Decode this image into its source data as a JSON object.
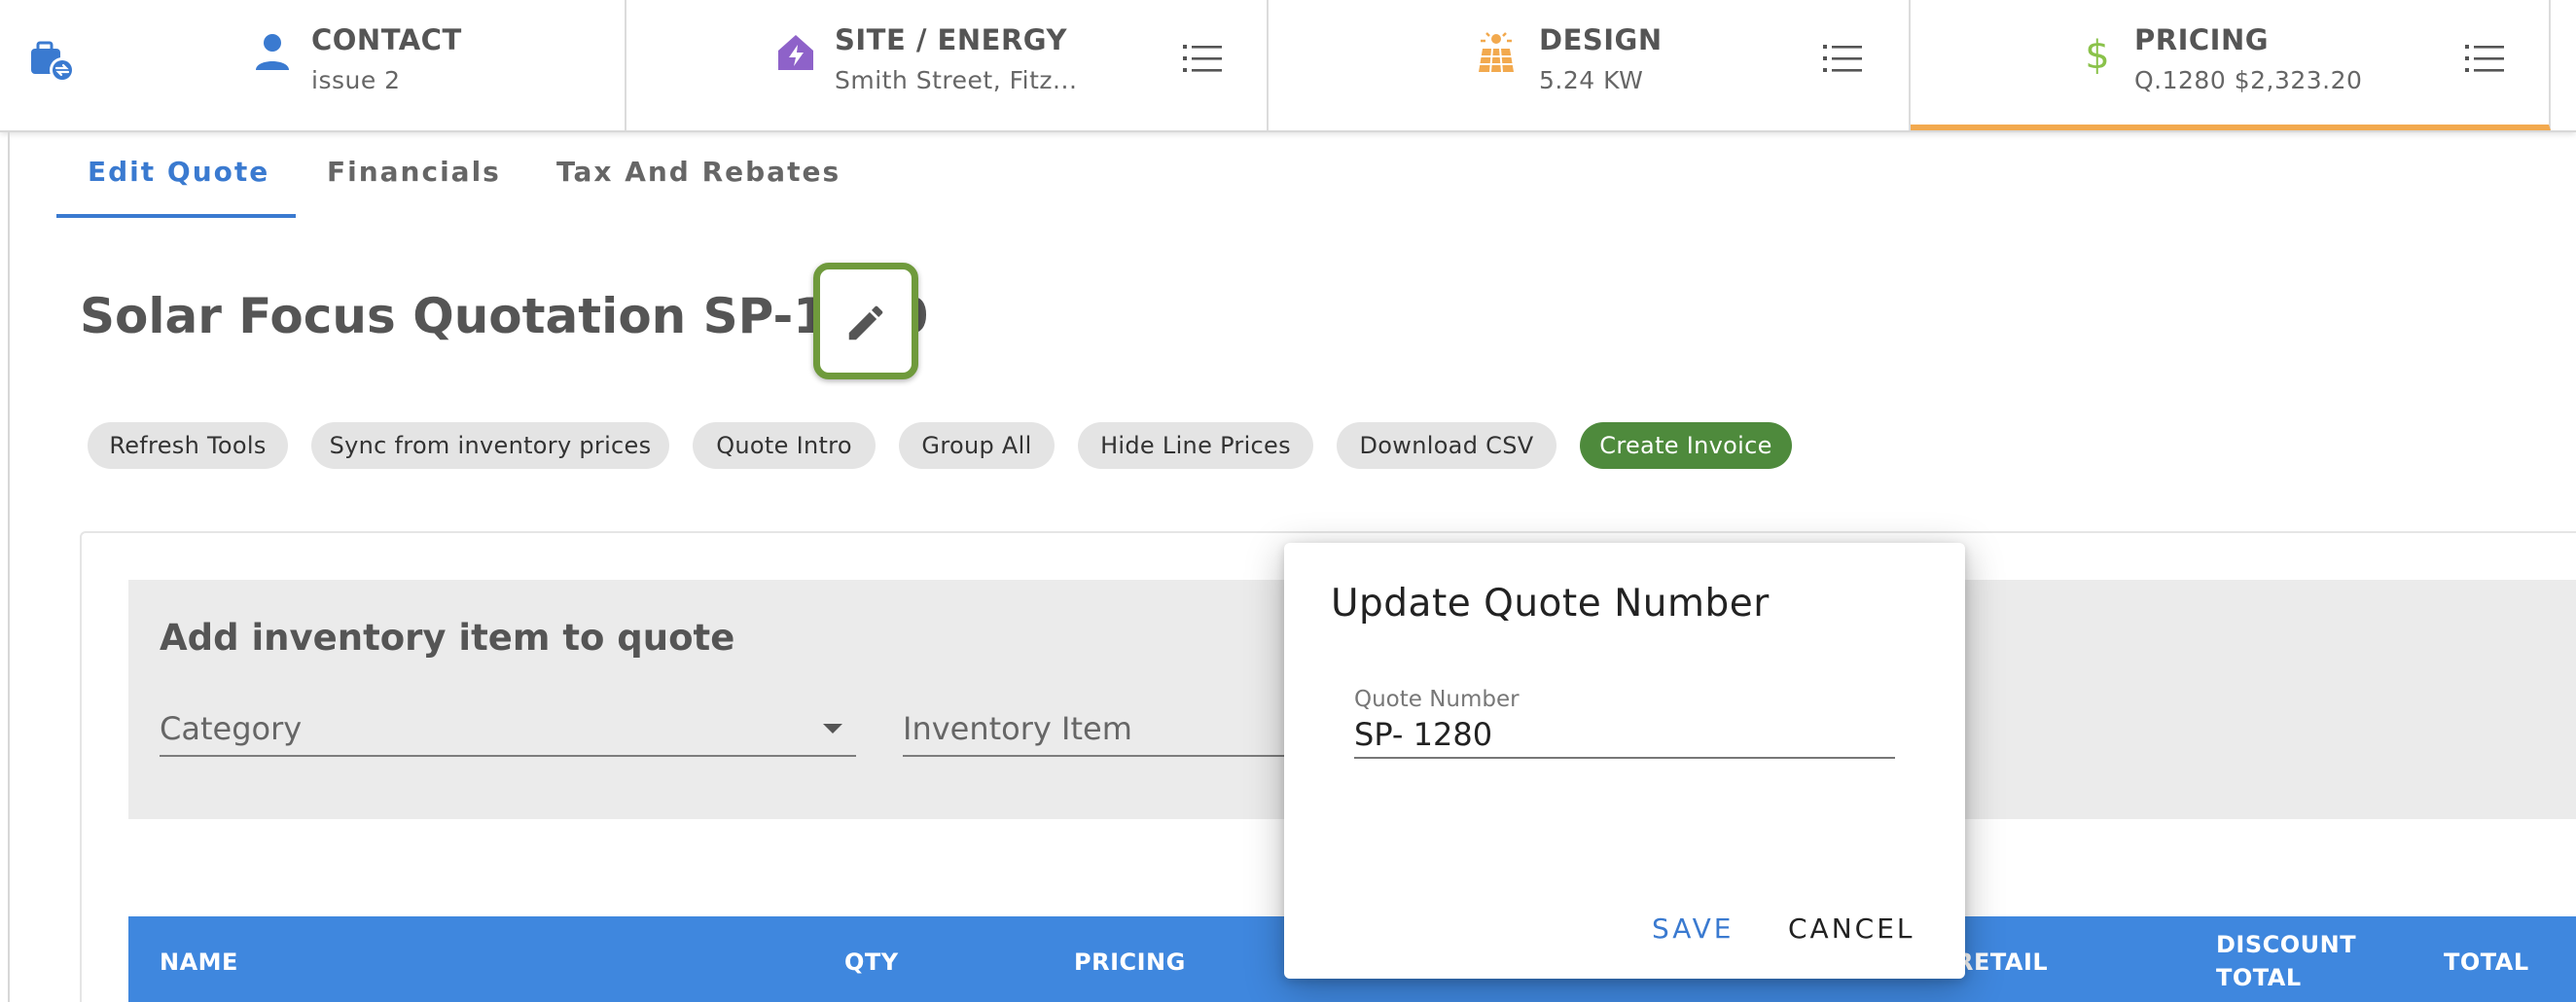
{
  "steps": [
    {
      "title": "CONTACT",
      "subtitle": "issue 2",
      "icon": "person-icon"
    },
    {
      "title": "SITE / ENERGY",
      "subtitle": "Smith Street, Fitz...",
      "icon": "house-bolt-icon"
    },
    {
      "title": "DESIGN",
      "subtitle": "5.24 KW",
      "icon": "solar-panel-icon"
    },
    {
      "title": "PRICING",
      "subtitle": "Q.1280 $2,323.20",
      "icon": "dollar-icon"
    }
  ],
  "tabs": [
    {
      "label": "Edit Quote",
      "active": true
    },
    {
      "label": "Financials",
      "active": false
    },
    {
      "label": "Tax And Rebates",
      "active": false
    }
  ],
  "page_title": "Solar Focus Quotation SP-1280",
  "actions": [
    "Refresh Tools",
    "Sync from inventory prices",
    "Quote Intro",
    "Group All",
    "Hide Line Prices",
    "Download CSV",
    "Create Invoice"
  ],
  "inventory": {
    "title": "Add inventory item to quote",
    "category_label": "Category",
    "item_label": "Inventory Item"
  },
  "table_headers": {
    "name": "NAME",
    "qty": "QTY",
    "pricing": "PRICING",
    "retail": "RETAIL",
    "discount_total_1": "DISCOUNT",
    "discount_total_2": "TOTAL",
    "total": "TOTAL"
  },
  "dialog": {
    "title": "Update Quote Number",
    "field_label": "Quote Number",
    "field_value": "SP- 1280",
    "save": "SAVE",
    "cancel": "CANCEL"
  },
  "colors": {
    "accent": "#3a7ad0",
    "active_step": "#f2a94e",
    "create_invoice": "#4e8a3c",
    "highlight": "#6f9a3c",
    "table_header": "#3f87de"
  }
}
